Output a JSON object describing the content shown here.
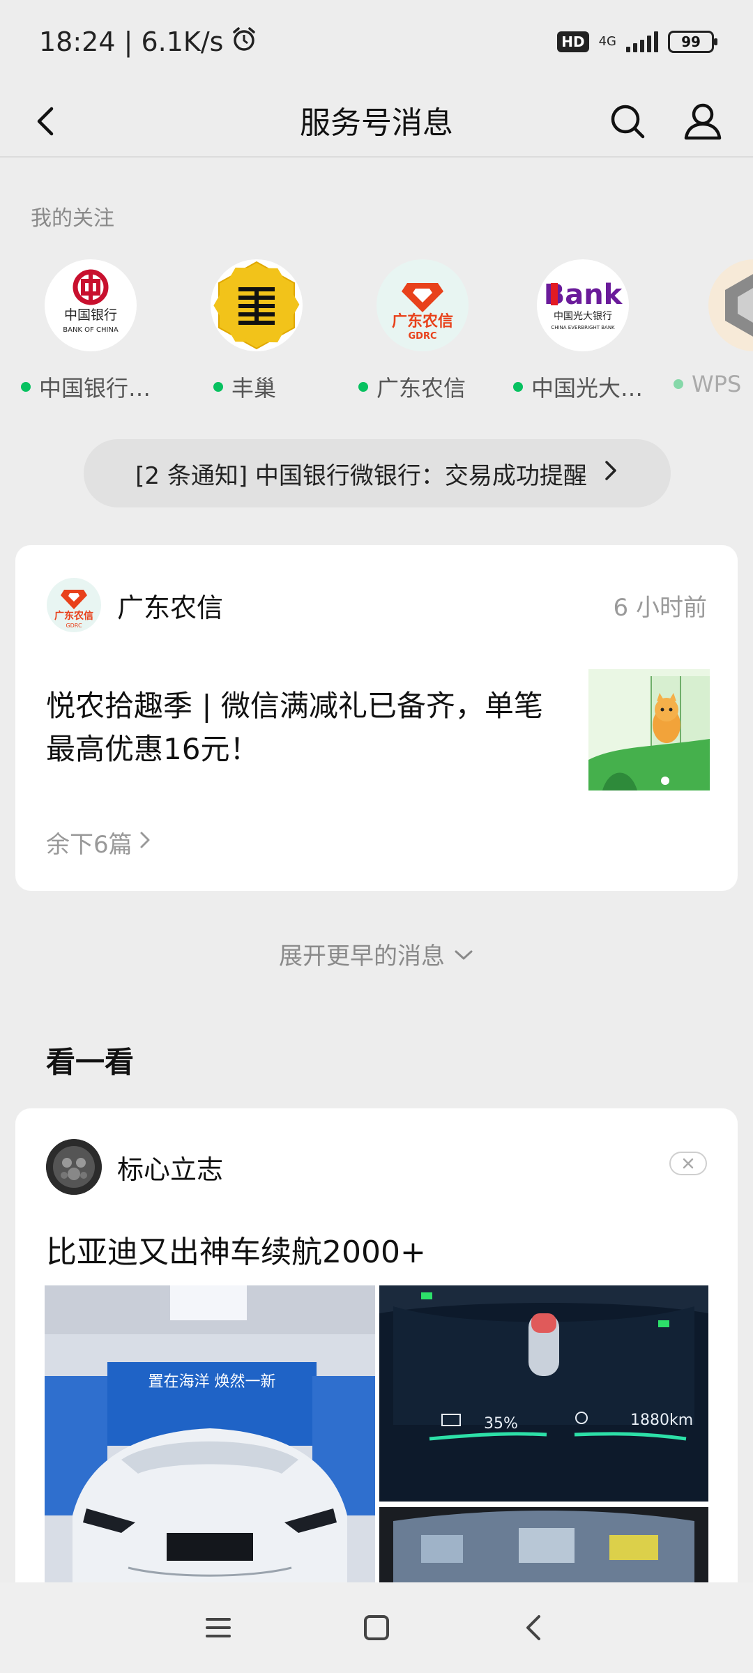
{
  "status_bar": {
    "time_speed": "18:24 | 6.1K/s",
    "hd": "HD",
    "network": "4G",
    "battery": "99"
  },
  "header": {
    "title": "服务号消息"
  },
  "following": {
    "title": "我的关注",
    "accounts": [
      {
        "name": "中国银行…",
        "logo_text": "中国银行",
        "logo_sub": "BANK OF CHINA"
      },
      {
        "name": "丰巢"
      },
      {
        "name": "广东农信",
        "logo_text": "广东农信",
        "logo_sub": "GDRC"
      },
      {
        "name": "中国光大…",
        "logo_text": "Bank",
        "logo_sub": "中国光大银行",
        "logo_sub2": "CHINA EVERBRIGHT BANK"
      },
      {
        "name": "WPS ",
        "partial": true
      }
    ]
  },
  "notice": {
    "text": "[2 条通知] 中国银行微银行：交易成功提醒"
  },
  "message_card": {
    "source": "广东农信",
    "avatar_text": "广东农信",
    "avatar_sub": "GDRC",
    "time": "6 小时前",
    "headline": "悦农拾趣季 | 微信满减礼已备齐，单笔最高优惠16元！",
    "more": "余下6篇"
  },
  "expand_label": "展开更早的消息",
  "discover": {
    "title": "看一看",
    "card": {
      "source": "标心立志",
      "headline": "比亚迪又出神车续航2000+",
      "banner_text": "置在海洋  焕然一新",
      "dash_battery": "35%",
      "dash_range": "1880km"
    }
  },
  "colors": {
    "accent_green": "#07c160",
    "boc_red": "#c8102e",
    "gdrc_red": "#e8411b",
    "fengchao_yellow": "#f2c31a"
  }
}
